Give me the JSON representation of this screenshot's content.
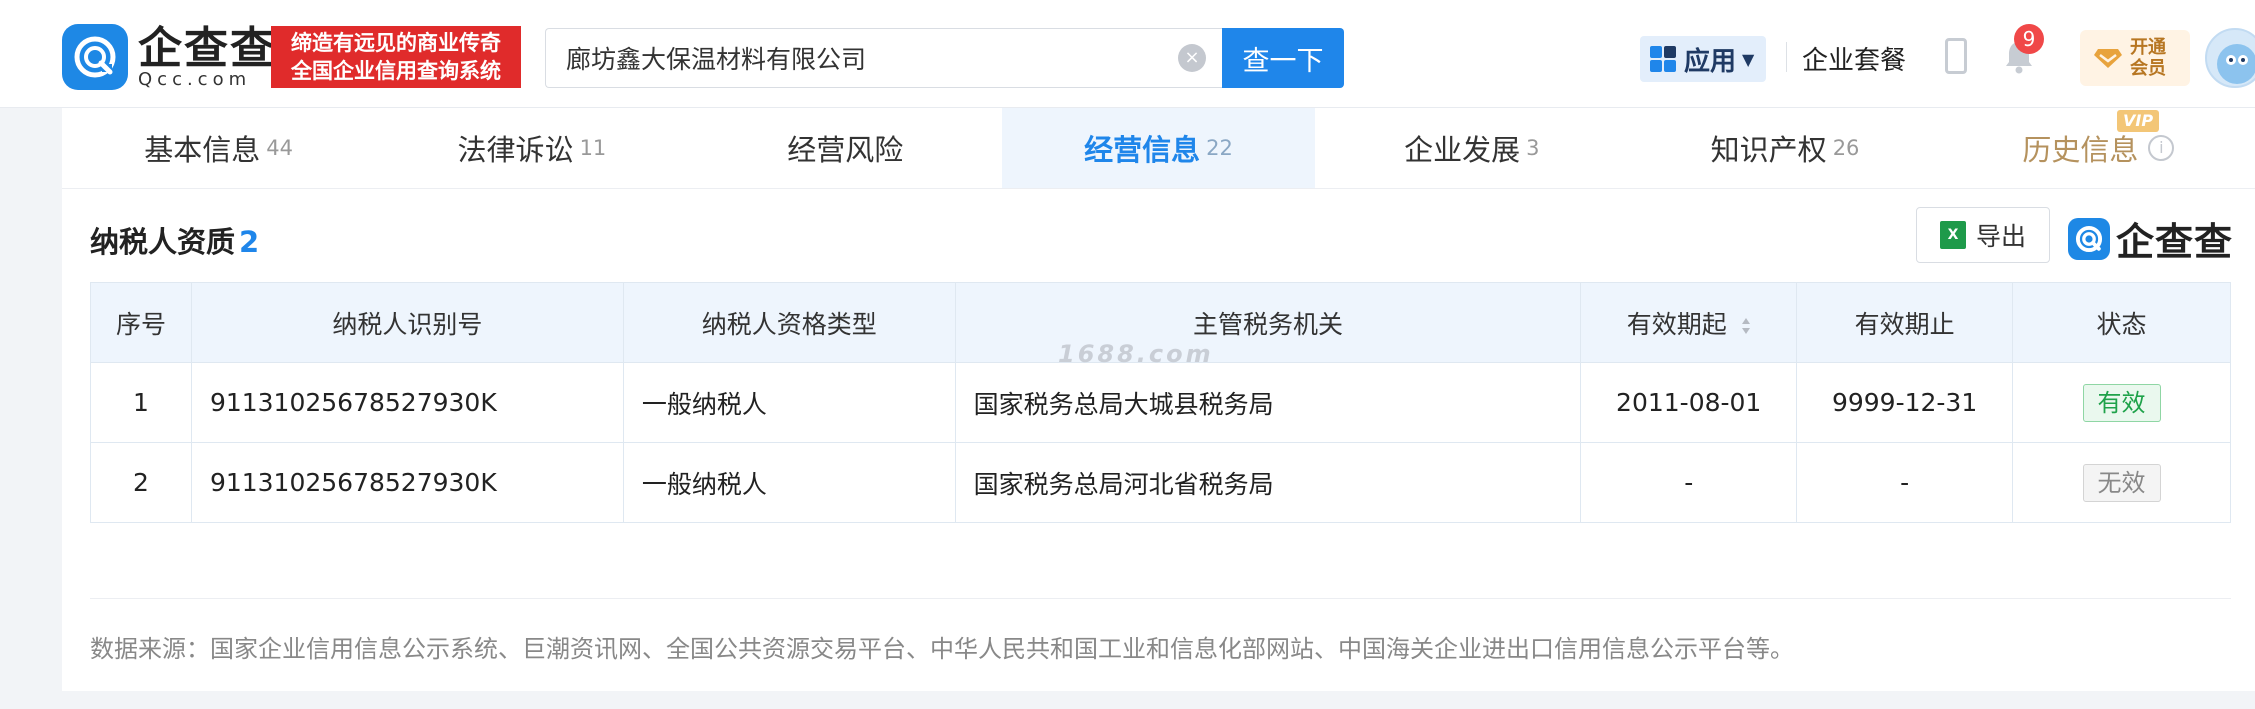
{
  "header": {
    "logo_cn": "企查查",
    "logo_en": "Qcc.com",
    "slogan_line1": "缔造有远见的商业传奇",
    "slogan_line2": "全国企业信用查询系统",
    "search_value": "廊坊鑫大保温材料有限公司",
    "search_button": "查一下",
    "apps_label": "应用",
    "package_link": "企业套餐",
    "notification_count": "9",
    "vip_line1": "开通",
    "vip_line2": "会员"
  },
  "tabs": [
    {
      "label": "基本信息",
      "count": "44"
    },
    {
      "label": "法律诉讼",
      "count": "11"
    },
    {
      "label": "经营风险",
      "count": ""
    },
    {
      "label": "经营信息",
      "count": "22"
    },
    {
      "label": "企业发展",
      "count": "3"
    },
    {
      "label": "知识产权",
      "count": "26"
    },
    {
      "label": "历史信息",
      "count": ""
    }
  ],
  "active_tab": "经营信息",
  "vip_tag": "VIP",
  "section": {
    "title": "纳税人资质",
    "count": "2",
    "export_label": "导出",
    "brand": "企查查"
  },
  "table": {
    "columns": [
      "序号",
      "纳税人识别号",
      "纳税人资格类型",
      "主管税务机关",
      "有效期起",
      "有效期止",
      "状态"
    ],
    "rows": [
      {
        "idx": "1",
        "tax_id": "91131025678527930K",
        "type": "一般纳税人",
        "authority": "国家税务总局大城县税务局",
        "from": "2011-08-01",
        "to": "9999-12-31",
        "status": "有效"
      },
      {
        "idx": "2",
        "tax_id": "91131025678527930K",
        "type": "一般纳税人",
        "authority": "国家税务总局河北省税务局",
        "from": "-",
        "to": "-",
        "status": "无效"
      }
    ]
  },
  "watermark": "1688.com",
  "source_text": "数据来源：国家企业信用信息公示系统、巨潮资讯网、全国公共资源交易平台、中华人民共和国工业和信息化部网站、中国海关企业进出口信用信息公示平台等。",
  "colors": {
    "brand_blue": "#1f86ea",
    "slogan_red": "#e02b2b",
    "valid_green": "#1fa24a",
    "vip_gold": "#b5925e"
  }
}
